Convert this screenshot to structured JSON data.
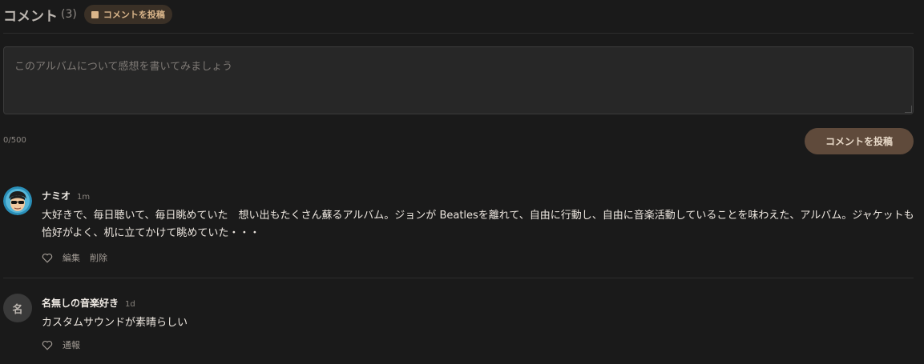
{
  "header": {
    "title": "コメント",
    "count": "(3)",
    "post_pill_label": "コメントを投稿"
  },
  "form": {
    "placeholder": "このアルバムについて感想を書いてみましょう",
    "counter": "0/500",
    "submit_label": "コメントを投稿"
  },
  "comments": [
    {
      "author": "ナミオ",
      "time": "1m",
      "text": "大好きで、毎日聴いて、毎日眺めていた　想い出もたくさん蘇るアルバム。ジョンが Beatlesを離れて、自由に行動し、自由に音楽活動していることを味わえた、アルバム。ジャケットも恰好がよく、机に立てかけて眺めていた・・・",
      "actions": [
        "編集",
        "削除"
      ]
    },
    {
      "author": "名無しの音楽好き",
      "avatar_letter": "名",
      "time": "1d",
      "text": "カスタムサウンドが素晴らしい",
      "actions": [
        "通報"
      ]
    }
  ],
  "colors": {
    "background": "#1a1a1a",
    "accent": "#d9b58a",
    "button_bg": "#5f4a3b"
  }
}
